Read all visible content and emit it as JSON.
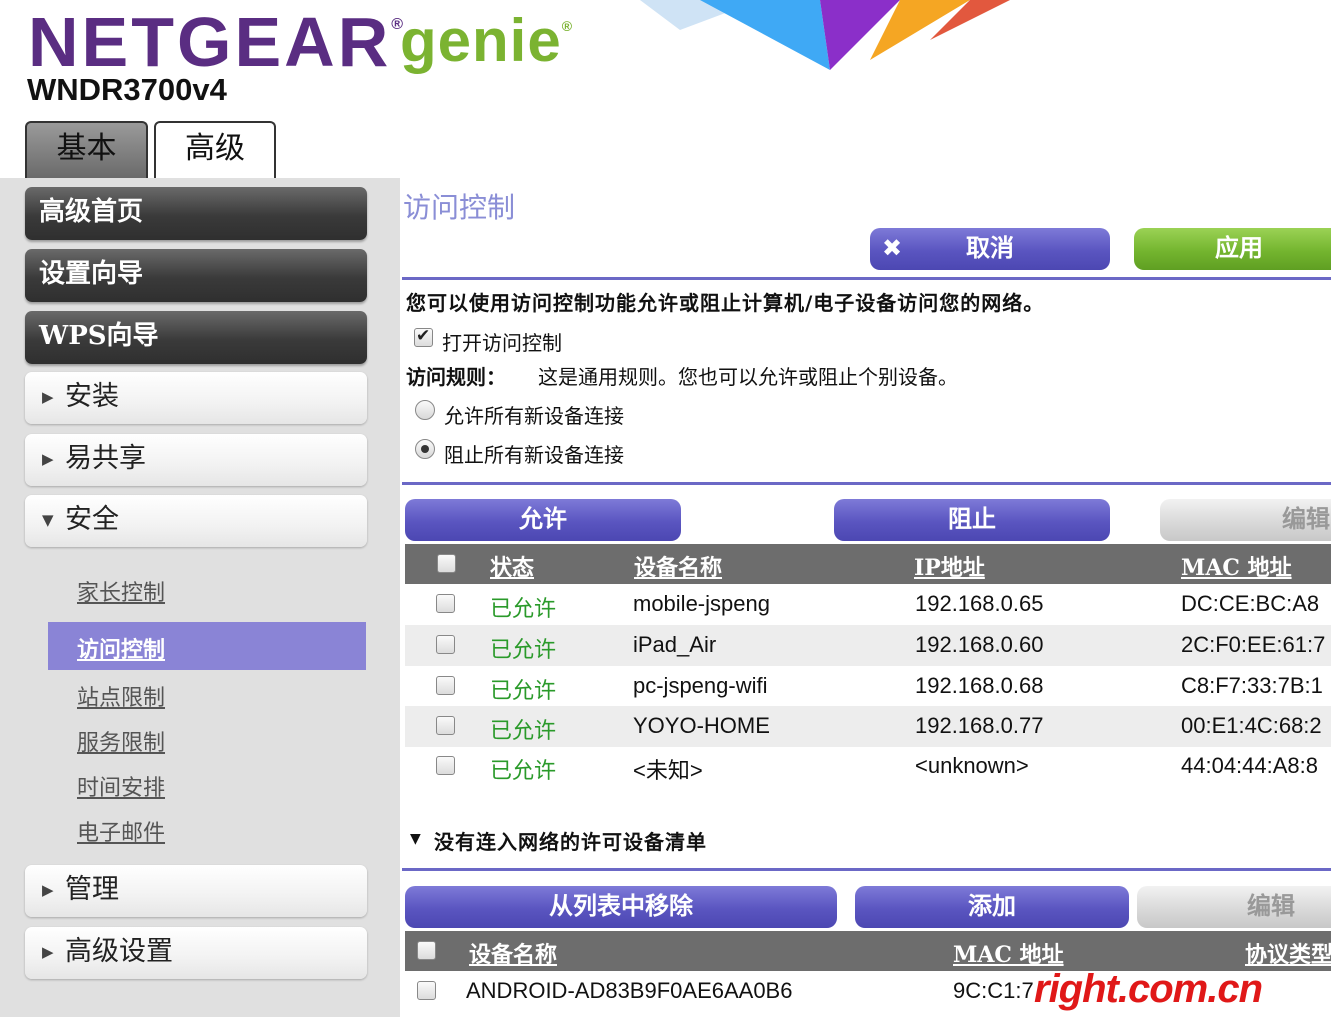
{
  "header": {
    "brand": "NETGEAR",
    "brand_reg": "®",
    "product": "genie",
    "product_reg": "®",
    "model": "WNDR3700v4",
    "tabs": [
      {
        "label": "基本",
        "active": false
      },
      {
        "label": "高级",
        "active": true
      }
    ]
  },
  "sidebar": {
    "primary": [
      {
        "label": "高级首页"
      },
      {
        "label": "设置向导"
      },
      {
        "label": "WPS向导"
      }
    ],
    "sections": [
      {
        "label": "安装",
        "expanded": false
      },
      {
        "label": "易共享",
        "expanded": false
      },
      {
        "label": "安全",
        "expanded": true
      },
      {
        "label": "管理",
        "expanded": false
      },
      {
        "label": "高级设置",
        "expanded": false
      }
    ],
    "security_items": [
      {
        "label": "家长控制"
      },
      {
        "label": "访问控制"
      },
      {
        "label": "站点限制"
      },
      {
        "label": "服务限制"
      },
      {
        "label": "时间安排"
      },
      {
        "label": "电子邮件"
      }
    ],
    "active_item": "访问控制"
  },
  "content": {
    "title": "访问控制",
    "buttons": {
      "cancel": "取消",
      "apply": "应用"
    },
    "description": "您可以使用访问控制功能允许或阻止计算机/电子设备访问您的网络。",
    "enable_label": "打开访问控制",
    "enable_checked": true,
    "rule_label": "访问规则：",
    "rule_text": "这是通用规则。您也可以允许或阻止个别设备。",
    "radio_options": [
      {
        "label": "允许所有新设备连接",
        "checked": false
      },
      {
        "label": "阻止所有新设备连接",
        "checked": true
      }
    ],
    "device_table": {
      "buttons": {
        "allow": "允许",
        "block": "阻止",
        "edit": "编辑"
      },
      "headers": [
        "状态",
        "设备名称",
        "IP地址",
        "MAC 地址"
      ],
      "rows": [
        {
          "status": "已允许",
          "name": "mobile-jspeng",
          "ip": "192.168.0.65",
          "mac": "DC:CE:BC:A8"
        },
        {
          "status": "已允许",
          "name": "iPad_Air",
          "ip": "192.168.0.60",
          "mac": "2C:F0:EE:61:7"
        },
        {
          "status": "已允许",
          "name": "pc-jspeng-wifi",
          "ip": "192.168.0.68",
          "mac": "C8:F7:33:7B:1"
        },
        {
          "status": "已允许",
          "name": "YOYO-HOME",
          "ip": "192.168.0.77",
          "mac": "00:E1:4C:68:2"
        },
        {
          "status": "已允许",
          "name": "<未知>",
          "ip": "<unknown>",
          "mac": "44:04:44:A8:8"
        }
      ]
    },
    "offline_section": {
      "title": "没有连入网络的许可设备清单",
      "buttons": {
        "remove": "从列表中移除",
        "add": "添加",
        "edit": "编辑"
      },
      "headers": [
        "设备名称",
        "MAC 地址",
        "协议类型"
      ],
      "rows": [
        {
          "name": "ANDROID-AD83B9F0AE6AA0B6",
          "mac": "9C:C1:7"
        }
      ]
    }
  },
  "watermark": "right.com.cn",
  "colors": {
    "accent_purple": "#5a55c0",
    "apply_green": "#74b52f",
    "brand_purple": "#5a2d82",
    "genie_green": "#7bb331",
    "status_green": "#2a9a2a"
  }
}
